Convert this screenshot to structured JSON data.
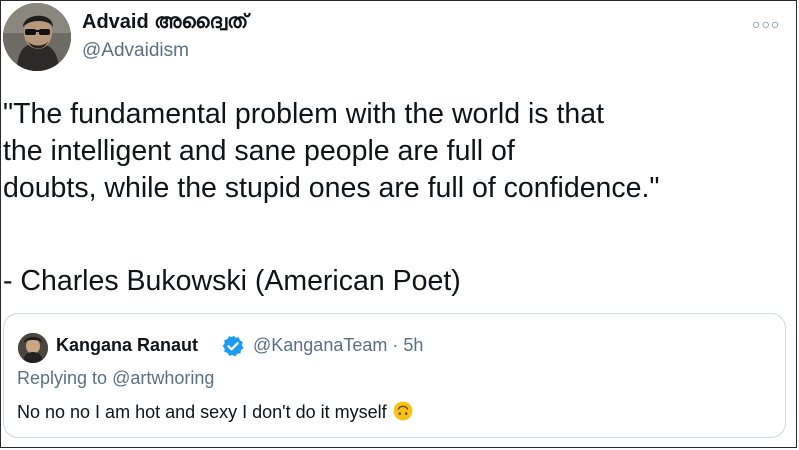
{
  "tweet": {
    "display_name": "Advaid അദ്വൈത്",
    "handle": "@Advaidism",
    "more_icon": "more-dots-icon",
    "text_lines": [
      "\"The fundamental problem with the world is that",
      "the intelligent and sane people are full of",
      "doubts, while the stupid ones are full of confidence.\""
    ],
    "attribution": "- Charles Bukowski (American Poet)"
  },
  "quoted_tweet": {
    "display_name": "Kangana Ranaut",
    "verified_icon": "verified-badge-icon",
    "handle": "@KanganaTeam",
    "separator": "·",
    "time": "5h",
    "replying_prefix": "Replying to",
    "replying_to": "@artwhoring",
    "text": "No no no I am hot and sexy I don't do it myself",
    "emoji_icon": "upside-down-face-emoji-icon"
  },
  "colors": {
    "text_primary": "#0f1419",
    "text_secondary": "#5b7083",
    "verified_blue": "#1d9bf0",
    "card_border": "#cfd9de",
    "emoji_yellow": "#f8c21b"
  }
}
